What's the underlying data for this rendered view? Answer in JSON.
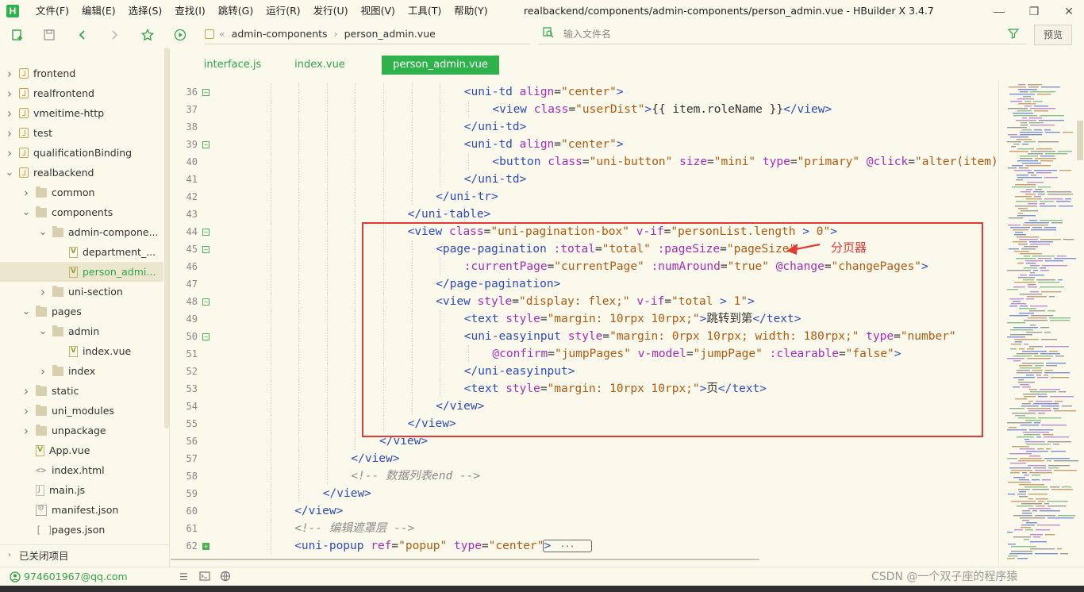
{
  "app": {
    "logo_letter": "H",
    "window_title": "realbackend/components/admin-components/person_admin.vue - HBuilder X 3.4.7",
    "accent_color": "#2fb24c"
  },
  "menu": [
    "文件(F)",
    "编辑(E)",
    "选择(S)",
    "查找(I)",
    "跳转(G)",
    "运行(R)",
    "发行(U)",
    "视图(V)",
    "工具(T)",
    "帮助(Y)"
  ],
  "toolbar": {
    "breadcrumb": [
      "admin-components",
      "person_admin.vue"
    ],
    "breadcrumb_sep": "«",
    "breadcrumb_sep2": "›",
    "file_search_placeholder": "输入文件名",
    "preview_label": "预览"
  },
  "sidebar": {
    "items": [
      {
        "label": "frontend",
        "type": "project",
        "arrow": "right"
      },
      {
        "label": "realfrontend",
        "type": "project",
        "arrow": "right"
      },
      {
        "label": "vmeitime-http",
        "type": "project",
        "arrow": "right"
      },
      {
        "label": "test",
        "type": "project",
        "arrow": "right"
      },
      {
        "label": "qualificationBinding",
        "type": "project",
        "arrow": "right"
      },
      {
        "label": "realbackend",
        "type": "project",
        "arrow": "down"
      },
      {
        "label": "common",
        "type": "folder",
        "arrow": "right"
      },
      {
        "label": "components",
        "type": "folder",
        "arrow": "down"
      },
      {
        "label": "admin-compone...",
        "type": "folder",
        "arrow": "down"
      },
      {
        "label": "department_...",
        "type": "vue",
        "arrow": ""
      },
      {
        "label": "person_admi...",
        "type": "vue",
        "arrow": "",
        "selected": true
      },
      {
        "label": "uni-section",
        "type": "folder",
        "arrow": "right"
      },
      {
        "label": "pages",
        "type": "folder",
        "arrow": "down"
      },
      {
        "label": "admin",
        "type": "folder",
        "arrow": "down"
      },
      {
        "label": "index.vue",
        "type": "vue",
        "arrow": ""
      },
      {
        "label": "index",
        "type": "folder",
        "arrow": "right"
      },
      {
        "label": "static",
        "type": "folder",
        "arrow": "right"
      },
      {
        "label": "uni_modules",
        "type": "folder",
        "arrow": "right"
      },
      {
        "label": "unpackage",
        "type": "folder",
        "arrow": "right"
      },
      {
        "label": "App.vue",
        "type": "vue",
        "arrow": ""
      },
      {
        "label": "index.html",
        "type": "html",
        "arrow": ""
      },
      {
        "label": "main.js",
        "type": "js",
        "arrow": ""
      },
      {
        "label": "manifest.json",
        "type": "json",
        "arrow": ""
      },
      {
        "label": "pages.json",
        "type": "bracket",
        "arrow": ""
      }
    ],
    "closed_projects_label": "已关闭项目"
  },
  "tabs": [
    {
      "label": "interface.js",
      "active": false
    },
    {
      "label": "index.vue",
      "active": false
    },
    {
      "label": "person_admin.vue",
      "active": true
    }
  ],
  "editor": {
    "lines": [
      {
        "num": "36",
        "fold": "open",
        "indent": 8,
        "segs": [
          [
            "t",
            "<uni-td "
          ],
          [
            "a",
            "align"
          ],
          [
            "s",
            "="
          ],
          [
            "v",
            "\"center\""
          ],
          [
            "t",
            ">"
          ]
        ]
      },
      {
        "num": "37",
        "fold": "",
        "indent": 9,
        "segs": [
          [
            "t",
            "<view "
          ],
          [
            "a",
            "class"
          ],
          [
            "s",
            "="
          ],
          [
            "v",
            "\"userDist\""
          ],
          [
            "t",
            ">"
          ],
          [
            "s",
            "{{ item.roleName }}"
          ],
          [
            "t",
            "</view>"
          ]
        ]
      },
      {
        "num": "38",
        "fold": "",
        "indent": 8,
        "segs": [
          [
            "t",
            "</uni-td>"
          ]
        ]
      },
      {
        "num": "39",
        "fold": "open",
        "indent": 8,
        "segs": [
          [
            "t",
            "<uni-td "
          ],
          [
            "a",
            "align"
          ],
          [
            "s",
            "="
          ],
          [
            "v",
            "\"center\""
          ],
          [
            "t",
            ">"
          ]
        ]
      },
      {
        "num": "40",
        "fold": "",
        "indent": 9,
        "segs": [
          [
            "t",
            "<button "
          ],
          [
            "a",
            "class"
          ],
          [
            "s",
            "="
          ],
          [
            "v",
            "\"uni-button\""
          ],
          [
            "s",
            " "
          ],
          [
            "a",
            "size"
          ],
          [
            "s",
            "="
          ],
          [
            "v",
            "\"mini\""
          ],
          [
            "s",
            " "
          ],
          [
            "a",
            "type"
          ],
          [
            "s",
            "="
          ],
          [
            "v",
            "\"primary\""
          ],
          [
            "s",
            " "
          ],
          [
            "a",
            "@click"
          ],
          [
            "s",
            "="
          ],
          [
            "v",
            "\"alter(item)\""
          ]
        ]
      },
      {
        "num": "41",
        "fold": "",
        "indent": 8,
        "segs": [
          [
            "t",
            "</uni-td>"
          ]
        ]
      },
      {
        "num": "42",
        "fold": "",
        "indent": 7,
        "segs": [
          [
            "t",
            "</uni-tr>"
          ]
        ]
      },
      {
        "num": "43",
        "fold": "",
        "indent": 6,
        "segs": [
          [
            "t",
            "</uni-table>"
          ]
        ]
      },
      {
        "num": "44",
        "fold": "open",
        "indent": 6,
        "segs": [
          [
            "t",
            "<view "
          ],
          [
            "a",
            "class"
          ],
          [
            "s",
            "="
          ],
          [
            "v",
            "\"uni-pagination-box\""
          ],
          [
            "s",
            " "
          ],
          [
            "a",
            "v-if"
          ],
          [
            "s",
            "="
          ],
          [
            "v",
            "\"personList.length "
          ],
          [
            "t",
            ">"
          ],
          [
            "v",
            " 0\""
          ],
          [
            "t",
            ">"
          ]
        ]
      },
      {
        "num": "45",
        "fold": "open",
        "indent": 7,
        "segs": [
          [
            "t",
            "<page-pagination "
          ],
          [
            "a",
            ":total"
          ],
          [
            "s",
            "="
          ],
          [
            "v",
            "\"total\""
          ],
          [
            "s",
            " "
          ],
          [
            "a",
            ":pageSize"
          ],
          [
            "s",
            "="
          ],
          [
            "v",
            "\"pageSize\""
          ]
        ]
      },
      {
        "num": "46",
        "fold": "",
        "indent": 8,
        "segs": [
          [
            "a",
            ":currentPage"
          ],
          [
            "s",
            "="
          ],
          [
            "v",
            "\"currentPage\""
          ],
          [
            "s",
            " "
          ],
          [
            "a",
            ":numAround"
          ],
          [
            "s",
            "="
          ],
          [
            "v",
            "\"true\""
          ],
          [
            "s",
            " "
          ],
          [
            "a",
            "@change"
          ],
          [
            "s",
            "="
          ],
          [
            "v",
            "\"changePages\""
          ],
          [
            "t",
            ">"
          ]
        ]
      },
      {
        "num": "47",
        "fold": "",
        "indent": 7,
        "segs": [
          [
            "t",
            "</page-pagination>"
          ]
        ]
      },
      {
        "num": "48",
        "fold": "open",
        "indent": 7,
        "segs": [
          [
            "t",
            "<view "
          ],
          [
            "a",
            "style"
          ],
          [
            "s",
            "="
          ],
          [
            "v",
            "\"display: flex;\""
          ],
          [
            "s",
            " "
          ],
          [
            "a",
            "v-if"
          ],
          [
            "s",
            "="
          ],
          [
            "v",
            "\"total "
          ],
          [
            "t",
            ">"
          ],
          [
            "v",
            " 1\""
          ],
          [
            "t",
            ">"
          ]
        ]
      },
      {
        "num": "49",
        "fold": "",
        "indent": 8,
        "segs": [
          [
            "t",
            "<text "
          ],
          [
            "a",
            "style"
          ],
          [
            "s",
            "="
          ],
          [
            "v",
            "\"margin: 10rpx 10rpx;\""
          ],
          [
            "t",
            ">"
          ],
          [
            "s",
            "跳转到第"
          ],
          [
            "t",
            "</text>"
          ]
        ]
      },
      {
        "num": "50",
        "fold": "open",
        "indent": 8,
        "segs": [
          [
            "t",
            "<uni-easyinput "
          ],
          [
            "a",
            "style"
          ],
          [
            "s",
            "="
          ],
          [
            "v",
            "\"margin: 0rpx 10rpx; width: 180rpx;\""
          ],
          [
            "s",
            " "
          ],
          [
            "a",
            "type"
          ],
          [
            "s",
            "="
          ],
          [
            "v",
            "\"number\""
          ]
        ]
      },
      {
        "num": "51",
        "fold": "",
        "indent": 9,
        "segs": [
          [
            "a",
            "@confirm"
          ],
          [
            "s",
            "="
          ],
          [
            "v",
            "\"jumpPages\""
          ],
          [
            "s",
            " "
          ],
          [
            "a",
            "v-model"
          ],
          [
            "s",
            "="
          ],
          [
            "v",
            "\"jumpPage\""
          ],
          [
            "s",
            " "
          ],
          [
            "a",
            ":clearable"
          ],
          [
            "s",
            "="
          ],
          [
            "v",
            "\"false\""
          ],
          [
            "t",
            ">"
          ]
        ]
      },
      {
        "num": "52",
        "fold": "",
        "indent": 8,
        "segs": [
          [
            "t",
            "</uni-easyinput>"
          ]
        ]
      },
      {
        "num": "53",
        "fold": "",
        "indent": 8,
        "segs": [
          [
            "t",
            "<text "
          ],
          [
            "a",
            "style"
          ],
          [
            "s",
            "="
          ],
          [
            "v",
            "\"margin: 10rpx 10rpx;\""
          ],
          [
            "t",
            ">"
          ],
          [
            "s",
            "页"
          ],
          [
            "t",
            "</text>"
          ]
        ]
      },
      {
        "num": "54",
        "fold": "",
        "indent": 7,
        "segs": [
          [
            "t",
            "</view>"
          ]
        ]
      },
      {
        "num": "55",
        "fold": "",
        "indent": 6,
        "segs": [
          [
            "t",
            "</view>"
          ]
        ]
      },
      {
        "num": "56",
        "fold": "",
        "indent": 5,
        "segs": [
          [
            "t",
            "</view>"
          ]
        ]
      },
      {
        "num": "57",
        "fold": "",
        "indent": 4,
        "segs": [
          [
            "t",
            "</view>"
          ]
        ]
      },
      {
        "num": "58",
        "fold": "",
        "indent": 4,
        "segs": [
          [
            "c",
            "<!-- 数据列表end -->"
          ]
        ]
      },
      {
        "num": "59",
        "fold": "",
        "indent": 3,
        "segs": [
          [
            "t",
            "</view>"
          ]
        ]
      },
      {
        "num": "60",
        "fold": "",
        "indent": 2,
        "segs": [
          [
            "t",
            "</view>"
          ]
        ]
      },
      {
        "num": "61",
        "fold": "",
        "indent": 2,
        "segs": [
          [
            "c",
            "<!-- 编辑遮罩层 -->"
          ]
        ]
      },
      {
        "num": "62",
        "fold": "closed",
        "indent": 2,
        "segs": [
          [
            "t",
            "<uni-popup "
          ],
          [
            "a",
            "ref"
          ],
          [
            "s",
            "="
          ],
          [
            "v",
            "\"popup\""
          ],
          [
            "s",
            " "
          ],
          [
            "a",
            "type"
          ],
          [
            "s",
            "="
          ],
          [
            "v",
            "\"center\""
          ],
          [
            "t",
            ">"
          ]
        ]
      }
    ],
    "fold_placeholder": "...",
    "annotation": "分页器"
  },
  "status": {
    "user": "974601967@qq.com",
    "watermark": "CSDN @一个双子座的程序猿"
  }
}
